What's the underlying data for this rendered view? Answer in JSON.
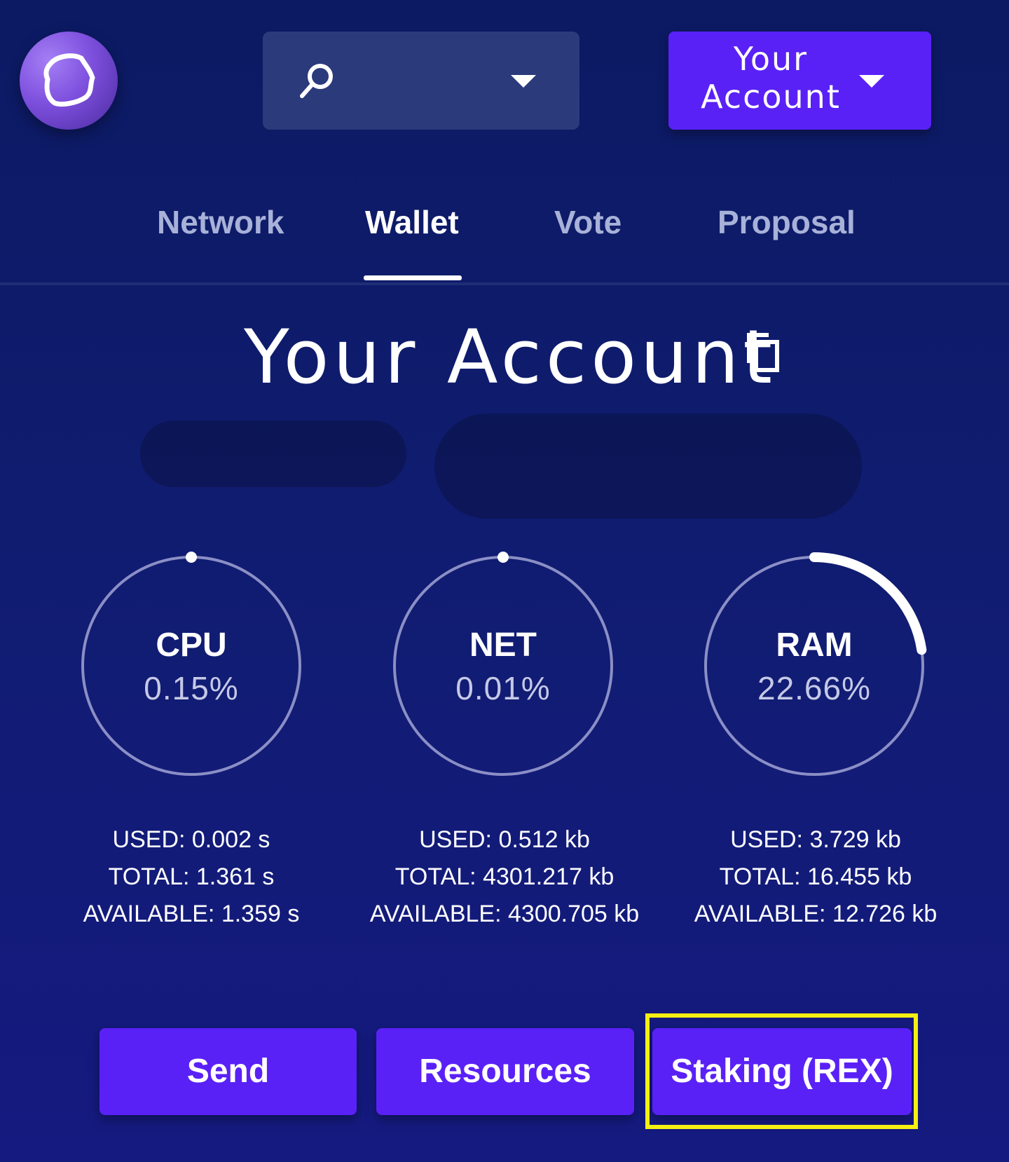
{
  "header": {
    "account_button_label": "Your Account"
  },
  "tabs": [
    {
      "label": "Network",
      "active": false
    },
    {
      "label": "Wallet",
      "active": true
    },
    {
      "label": "Vote",
      "active": false
    },
    {
      "label": "Proposal",
      "active": false
    }
  ],
  "main": {
    "title": "Your Account"
  },
  "resources": [
    {
      "name": "CPU",
      "percent_label": "0.15%",
      "fraction": 0.0015,
      "used": "USED: 0.002 s",
      "total": "TOTAL: 1.361 s",
      "available": "AVAILABLE: 1.359 s"
    },
    {
      "name": "NET",
      "percent_label": "0.01%",
      "fraction": 0.0001,
      "used": "USED: 0.512 kb",
      "total": "TOTAL: 4301.217 kb",
      "available": "AVAILABLE: 4300.705 kb"
    },
    {
      "name": "RAM",
      "percent_label": "22.66%",
      "fraction": 0.2266,
      "used": "USED: 3.729 kb",
      "total": "TOTAL: 16.455 kb",
      "available": "AVAILABLE: 12.726 kb"
    }
  ],
  "actions": {
    "send": "Send",
    "resources": "Resources",
    "staking": "Staking (REX)"
  },
  "colors": {
    "accent": "#5a21f6",
    "highlight": "#f5f012",
    "background": "#101c70"
  },
  "icons": [
    "logo-icon",
    "search-icon",
    "chevron-down-icon",
    "copy-icon"
  ]
}
